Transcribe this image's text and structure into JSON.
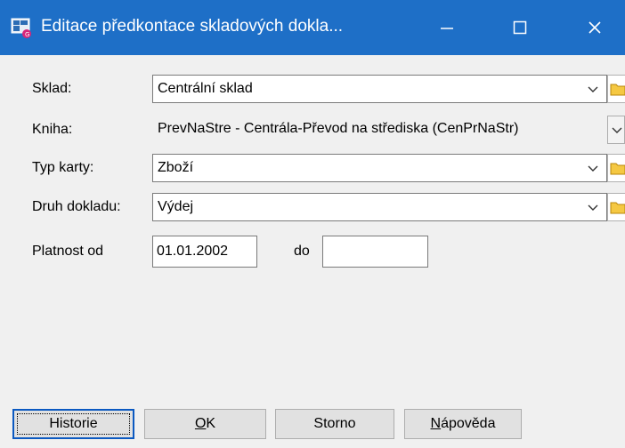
{
  "window": {
    "title": "Editace předkontace skladových dokla..."
  },
  "form": {
    "sklad": {
      "label": "Sklad:",
      "value": "Centrální sklad"
    },
    "kniha": {
      "label": "Kniha:",
      "value": "PrevNaStre - Centrála-Převod na střediska (CenPrNaStr)"
    },
    "typ_karty": {
      "label": "Typ karty:",
      "value": "Zboží"
    },
    "druh_dokladu": {
      "label": "Druh dokladu:",
      "value": "Výdej"
    },
    "platnost": {
      "label_od": "Platnost od",
      "od_value": "01.01.2002",
      "label_do": "do",
      "do_value": ""
    }
  },
  "buttons": {
    "historie": "Historie",
    "ok_underline": "O",
    "ok_rest": "K",
    "storno": "Storno",
    "napoveda_underline": "N",
    "napoveda_rest": "ápověda"
  },
  "colors": {
    "titlebar": "#1e6fc7",
    "background": "#f0f0f0",
    "focus_border": "#0b59c1"
  }
}
